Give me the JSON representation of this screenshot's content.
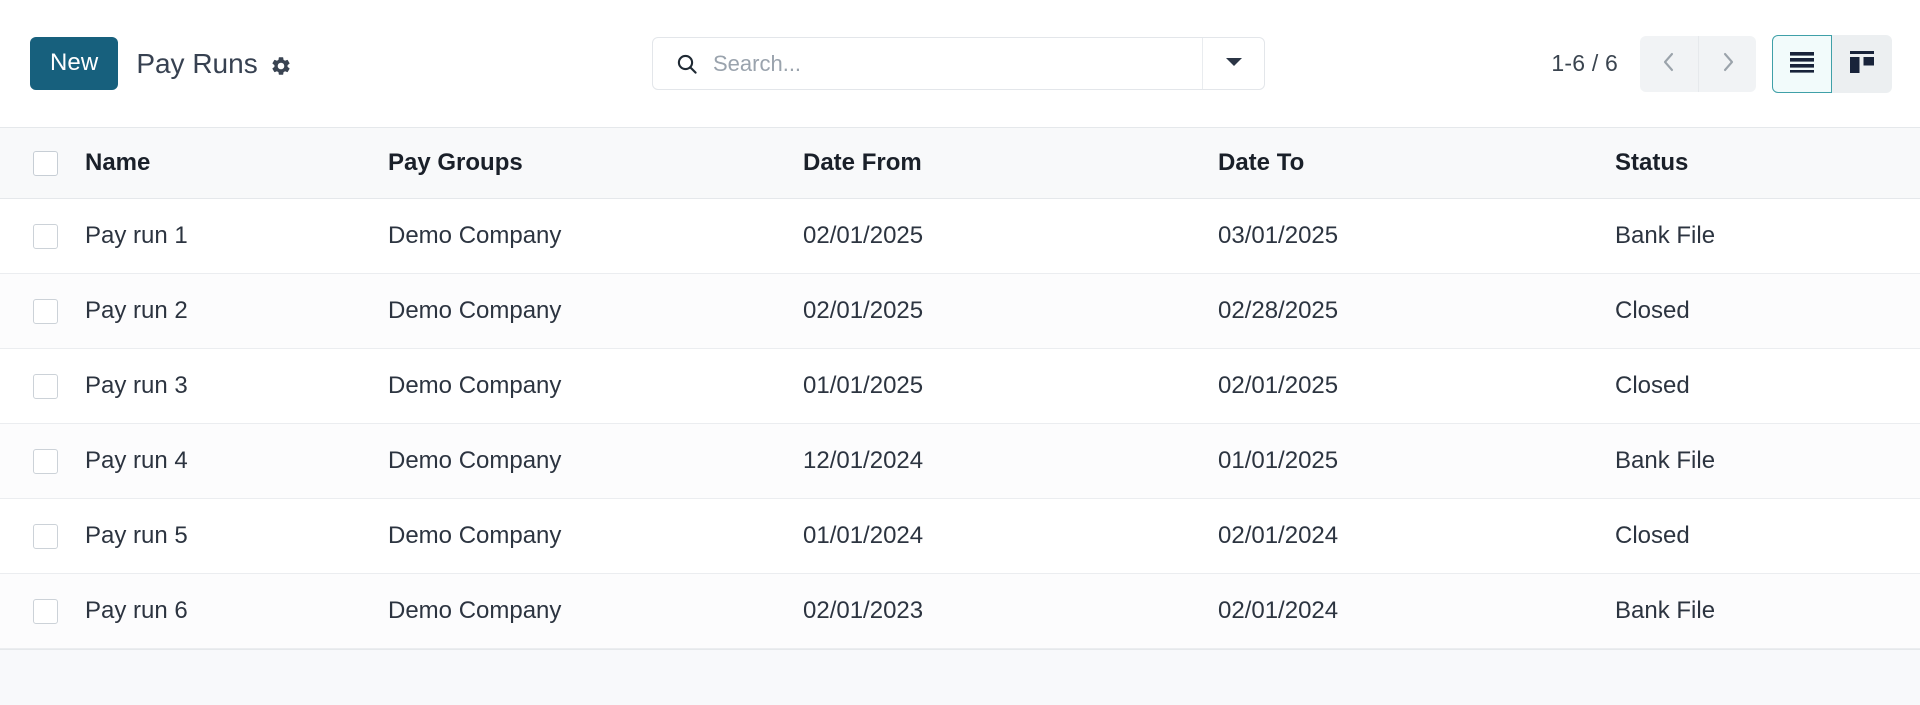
{
  "toolbar": {
    "new_label": "New",
    "page_title": "Pay Runs",
    "settings_icon": "gear-icon"
  },
  "search": {
    "placeholder": "Search...",
    "value": "",
    "icon": "search-icon",
    "dropdown_icon": "caret-down-icon"
  },
  "pager": {
    "count_label": "1-6 / 6",
    "prev_icon": "chevron-left-icon",
    "next_icon": "chevron-right-icon"
  },
  "views": {
    "list_icon": "list-view-icon",
    "kanban_icon": "kanban-view-icon",
    "active": "list",
    "active_accent": "#3fa0a8"
  },
  "colors": {
    "primary": "#17607D",
    "header_bg": "#f8f9fa",
    "text": "#2c3440",
    "border": "#e5e8eb"
  },
  "table": {
    "columns": [
      "Name",
      "Pay Groups",
      "Date From",
      "Date To",
      "Status"
    ],
    "rows": [
      {
        "name": "Pay run 1",
        "pay_group": "Demo Company",
        "date_from": "02/01/2025",
        "date_to": "03/01/2025",
        "status": "Bank File"
      },
      {
        "name": "Pay run 2",
        "pay_group": "Demo Company",
        "date_from": "02/01/2025",
        "date_to": "02/28/2025",
        "status": "Closed"
      },
      {
        "name": "Pay run 3",
        "pay_group": "Demo Company",
        "date_from": "01/01/2025",
        "date_to": "02/01/2025",
        "status": "Closed"
      },
      {
        "name": "Pay run 4",
        "pay_group": "Demo Company",
        "date_from": "12/01/2024",
        "date_to": "01/01/2025",
        "status": "Bank File"
      },
      {
        "name": "Pay run 5",
        "pay_group": "Demo Company",
        "date_from": "01/01/2024",
        "date_to": "02/01/2024",
        "status": "Closed"
      },
      {
        "name": "Pay run 6",
        "pay_group": "Demo Company",
        "date_from": "02/01/2023",
        "date_to": "02/01/2024",
        "status": "Bank File"
      }
    ]
  }
}
